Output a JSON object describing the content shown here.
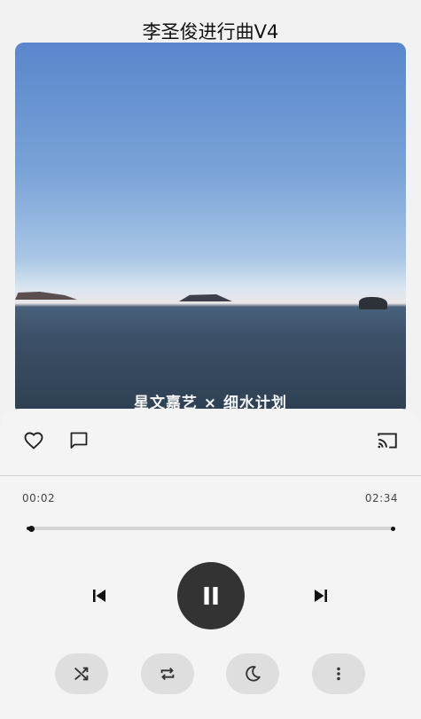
{
  "player": {
    "title": "李圣俊进行曲V4",
    "cover_watermark": "星文嘉艺 × 细水计划"
  },
  "actions": {
    "like": "heart-icon",
    "comment": "comment-icon",
    "cast": "cast-icon"
  },
  "progress": {
    "current_time": "00:02",
    "total_time": "02:34",
    "fraction": 0.013
  },
  "controls": {
    "previous": "skip-previous-icon",
    "play_pause": "pause-icon",
    "next": "skip-next-icon"
  },
  "bottom_bar": [
    "shuffle-icon",
    "repeat-icon",
    "sleep-timer-moon-icon",
    "more-vertical-icon"
  ],
  "colors": {
    "background": "#f2f2f2",
    "play_button": "#333333",
    "pill": "#dedede",
    "icon": "#222222"
  }
}
